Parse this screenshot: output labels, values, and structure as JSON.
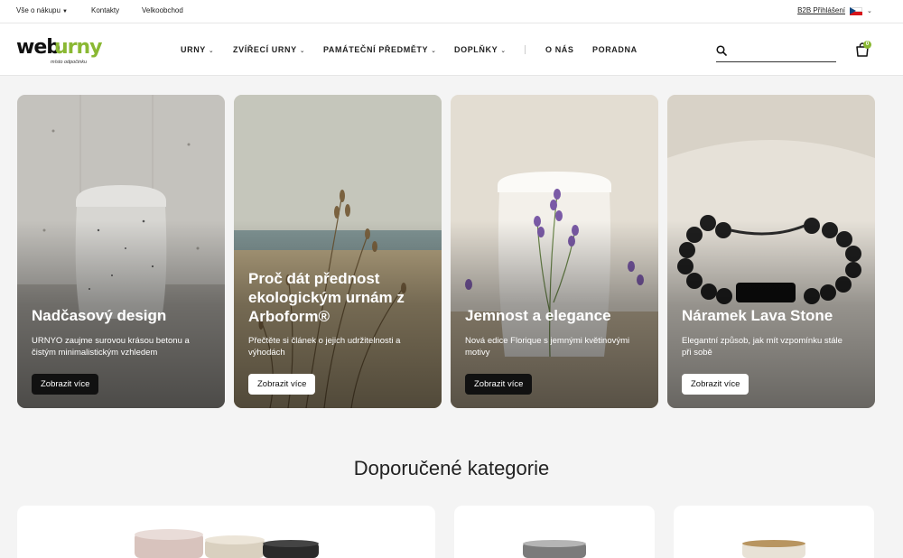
{
  "topbar": {
    "links": [
      "Vše o nákupu",
      "Kontakty",
      "Velkoobchod"
    ],
    "b2b_label": "B2B Přihlášení",
    "language_icon": "czech-flag-icon"
  },
  "header": {
    "logo_part1": "web",
    "logo_part2": "urny",
    "logo_tagline": "místo odpočinku",
    "nav": [
      "URNY",
      "ZVÍŘECÍ URNY",
      "PAMÁTEČNÍ PŘEDMĚTY",
      "DOPLŇKY",
      "O NÁS",
      "PORADNA"
    ],
    "search_placeholder": "",
    "cart_count": "0"
  },
  "hero": [
    {
      "title": "Nadčasový design",
      "text": "URNYO zaujme surovou krásou betonu a čistým minimalistickým vzhledem",
      "button": "Zobrazit více"
    },
    {
      "title": "Proč dát přednost ekologickým urnám z Arboform®",
      "text": "Přečtěte si článek o jejich udržitelnosti a výhodách",
      "button": "Zobrazit více"
    },
    {
      "title": "Jemnost a elegance",
      "text": "Nová edice Florique s jemnými květinovými motivy",
      "button": "Zobrazit více"
    },
    {
      "title": "Náramek Lava Stone",
      "text": "Elegantní způsob, jak mít vzpomínku stále při sobě",
      "button": "Zobrazit více"
    }
  ],
  "categories_section": {
    "title": "Doporučené kategorie"
  },
  "colors": {
    "brand_green": "#8ab833",
    "dark_button": "#111111",
    "page_bg": "#f4f4f4"
  }
}
